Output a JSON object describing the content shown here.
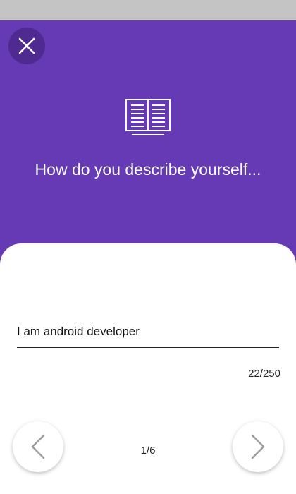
{
  "colors": {
    "header_bg": "#6639b5",
    "close_button_bg": "#4e2a91",
    "status_bar_bg": "#c4c4c4",
    "card_bg": "#ffffff"
  },
  "icons": {
    "close": "close-icon",
    "header": "open-book-icon",
    "previous": "chevron-left-icon",
    "next": "chevron-right-icon"
  },
  "header": {
    "title": "How do you describe yourself..."
  },
  "answer": {
    "value": "I am android developer",
    "char_count": "22/250"
  },
  "pagination": {
    "indicator": "1/6"
  }
}
